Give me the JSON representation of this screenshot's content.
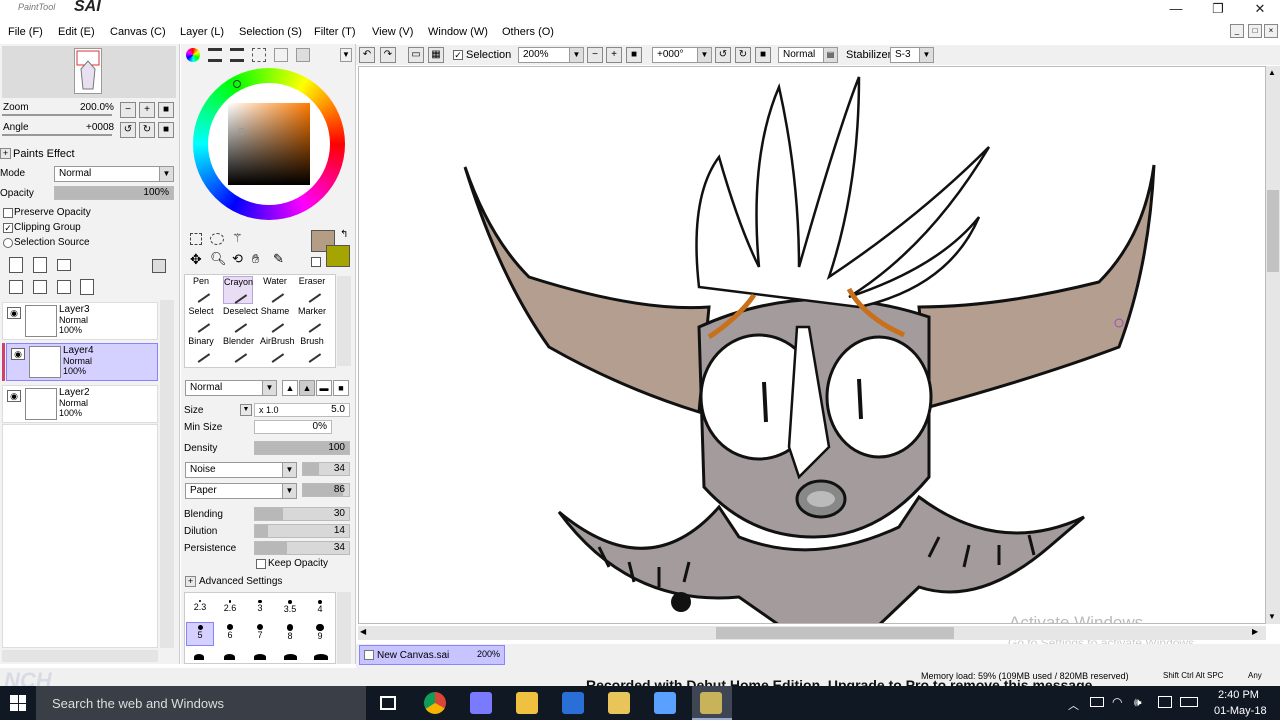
{
  "app": {
    "logo_small": "PaintTool",
    "logo_big": "SAI"
  },
  "window_controls": {
    "minimize": "—",
    "restore": "❐",
    "close": "✕"
  },
  "menu": [
    "File (F)",
    "Edit (E)",
    "Canvas (C)",
    "Layer (L)",
    "Selection (S)",
    "Filter (T)",
    "View (V)",
    "Window (W)",
    "Others (O)"
  ],
  "navigator": {
    "zoom_label": "Zoom",
    "zoom_value": "200.0%",
    "angle_label": "Angle",
    "angle_value": "+0008"
  },
  "layer_props": {
    "paints_effect": "Paints Effect",
    "mode_label": "Mode",
    "mode_value": "Normal",
    "opacity_label": "Opacity",
    "opacity_value": "100%",
    "opacity_level": 1.0,
    "preserve_opacity": "Preserve Opacity",
    "clipping_group": "Clipping Group",
    "selection_source": "Selection Source"
  },
  "layers": [
    {
      "name": "Layer3",
      "mode": "Normal",
      "opacity": "100%",
      "selected": false
    },
    {
      "name": "Layer4",
      "mode": "Normal",
      "opacity": "100%",
      "selected": true
    },
    {
      "name": "Layer2",
      "mode": "Normal",
      "opacity": "100%",
      "selected": false
    }
  ],
  "colors": {
    "primary": "#b49c85",
    "secondary": "#a5a400",
    "selected_layer": "#d4d0ff",
    "accent_orange": "#c8701a"
  },
  "tools": [
    {
      "label": "Pen"
    },
    {
      "label": "Crayon",
      "selected": true
    },
    {
      "label": "Water"
    },
    {
      "label": "Eraser"
    },
    {
      "label": "Select"
    },
    {
      "label": "Deselect"
    },
    {
      "label": "Shame"
    },
    {
      "label": "Marker"
    },
    {
      "label": "Binary"
    },
    {
      "label": "Blender"
    },
    {
      "label": "AirBrush"
    },
    {
      "label": "Brush"
    }
  ],
  "brush": {
    "blend_mode": "Normal",
    "size_label": "Size",
    "size_mult": "x 1.0",
    "size_value": "5.0",
    "min_size_label": "Min Size",
    "min_size_value": "0%",
    "density_label": "Density",
    "density_value": "100",
    "density_level": 1.0,
    "noise_label": "Noise",
    "noise_value": "34",
    "noise_level": 0.34,
    "paper_label": "Paper",
    "paper_value": "86",
    "paper_level": 0.86,
    "blending_label": "Blending",
    "blending_value": "30",
    "blending_level": 0.3,
    "dilution_label": "Dilution",
    "dilution_value": "14",
    "dilution_level": 0.14,
    "persistence_label": "Persistence",
    "persistence_value": "34",
    "persistence_level": 0.34,
    "keep_opacity": "Keep Opacity",
    "advanced_settings": "Advanced Settings",
    "size_presets_row1": [
      "2.3",
      "2.6",
      "3",
      "3.5",
      "4"
    ],
    "size_presets_row2": [
      "5",
      "6",
      "7",
      "8",
      "9"
    ]
  },
  "toolbar": {
    "selection_label": "Selection",
    "zoom_value": "200%",
    "angle_value": "+000°",
    "blend_mode": "Normal",
    "stabilizer_label": "Stabilizer",
    "stabilizer_value": "S-3"
  },
  "canvas_tab": {
    "name": "New Canvas.sai",
    "zoom": "200%"
  },
  "status": {
    "memory": "Memory load: 59% (109MB used / 820MB reserved)",
    "keys": "Shift Ctrl Alt SPC",
    "any": "Any"
  },
  "watermark": {
    "activate_title": "Activate Windows",
    "activate_sub": "Go to Settings to activate Windows.",
    "recorded": "Recorded with Debut Home Edition. Upgrade to Pro to remove this message.",
    "nch": "NCH"
  },
  "taskbar": {
    "search_placeholder": "Search the web and Windows",
    "time": "2:40 PM",
    "date": "01-May-18"
  }
}
